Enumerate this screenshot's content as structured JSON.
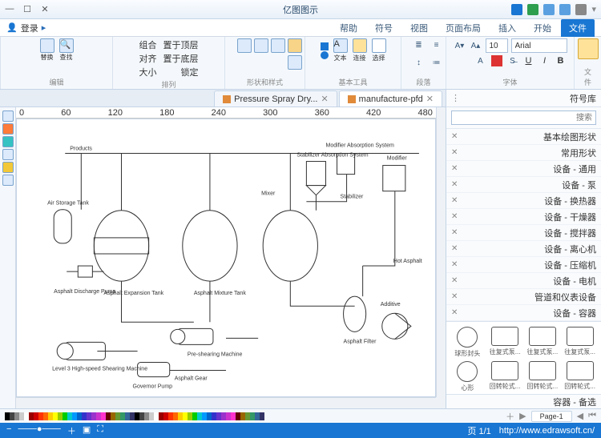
{
  "app": {
    "title": "亿图图示"
  },
  "qat_icons": [
    "home",
    "save",
    "undo",
    "redo",
    "print",
    "help"
  ],
  "menu": {
    "tabs": [
      "文件",
      "开始",
      "插入",
      "页面布局",
      "视图",
      "符号",
      "帮助"
    ],
    "active": "开始",
    "login": "登录"
  },
  "ribbon": {
    "file_label": "文件",
    "font": {
      "label": "字体",
      "name": "Arial",
      "size": "10"
    },
    "para_label": "段落",
    "tools": {
      "label": "基本工具",
      "text": "文本",
      "connector": "连接",
      "select": "选择"
    },
    "shapefmt_label": "形状和样式",
    "arrange": {
      "label": "排列",
      "items": [
        "置于顶层",
        "置于底层",
        "锁定",
        "组合",
        "对齐",
        "大小"
      ]
    },
    "edit": {
      "label": "编辑",
      "find": "查找",
      "replace": "替换"
    }
  },
  "doctabs": [
    {
      "label": "manufacture-pfd",
      "active": true
    },
    {
      "label": "Pressure Spray Dry...",
      "active": false
    }
  ],
  "ruler_marks": [
    "0",
    "60",
    "120",
    "180",
    "240",
    "300",
    "360",
    "420",
    "480"
  ],
  "side": {
    "title": "符号库",
    "search_ph": "搜索",
    "cats": [
      "基本绘图形状",
      "常用形状",
      "设备 - 通用",
      "设备 - 泵",
      "设备 - 换热器",
      "设备 - 干燥器",
      "设备 - 搅拌器",
      "设备 - 离心机",
      "设备 - 压缩机",
      "设备 - 电机",
      "管道和仪表设备",
      "设备 - 容器"
    ],
    "shapes": [
      "球形封头",
      "往复式泵...",
      "往复式泵...",
      "往复式泵...",
      "心形",
      "回转轮式...",
      "回转轮式...",
      "回转轮式..."
    ],
    "foot": "容器 - 备选"
  },
  "diagram": {
    "labels": {
      "products": "Products",
      "modifier": "Modifier",
      "modabs": "Modifier Absorption System",
      "stababs": "Stabilizer Absorption System",
      "stabiliz": "Stabilizer",
      "mixer": "Mixer",
      "airstor": "Air Storage Tank",
      "hotasph": "Hot Asphalt",
      "asdisch": "Asphalt Discharge Pump",
      "asexp": "Asphalt Expansion Tank",
      "asmix": "Asphalt Mixture Tank",
      "additive": "Additive",
      "asfilt": "Asphalt Filter",
      "preshear": "Pre-shearing Machine",
      "l3": "Level 3 High-speed Shearing Machine",
      "gov": "Governor Pump",
      "asgear": "Asphalt Gear"
    }
  },
  "pagebar": {
    "page": "Page-1"
  },
  "status": {
    "url": "http://www.edrawsoft.cn/",
    "page": "页 1/1"
  }
}
